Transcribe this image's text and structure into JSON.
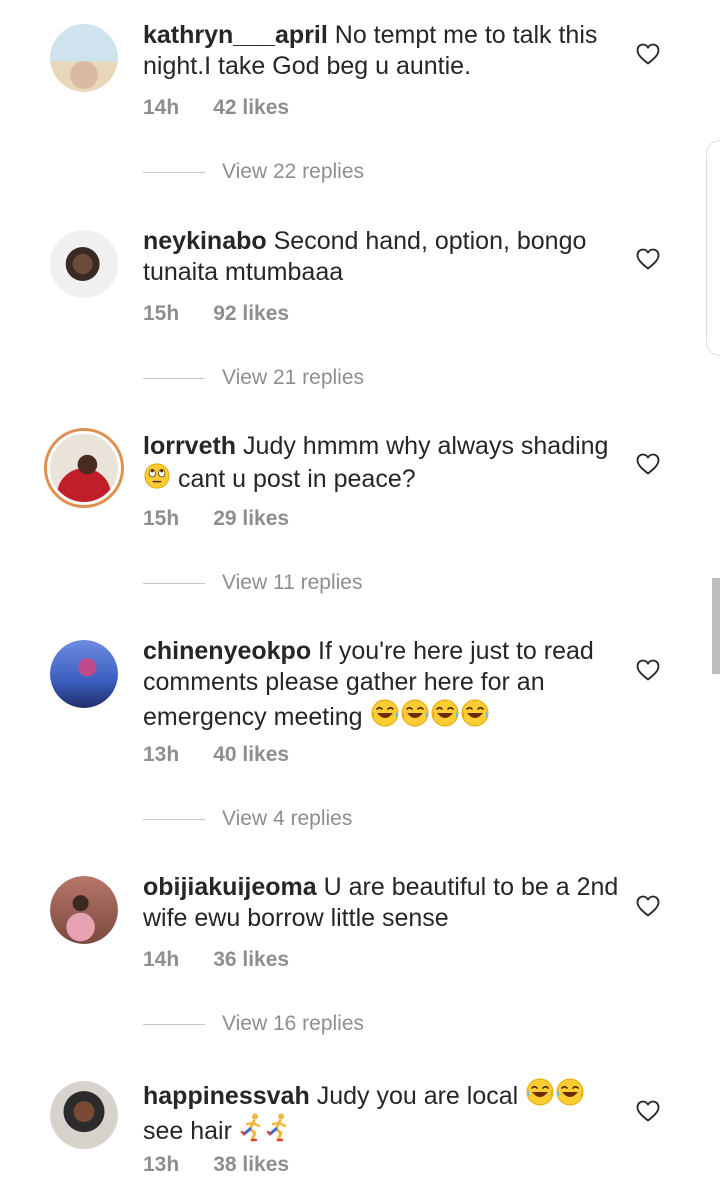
{
  "comments": [
    {
      "username": "kathryn___april",
      "text": "No tempt me to talk this night.I take God beg u auntie.",
      "time": "14h",
      "likes": "42 likes",
      "replies": "View 22 replies",
      "avatar_colors": [
        "#cfe3ef",
        "#d9b9a0"
      ]
    },
    {
      "username": "neykinabo",
      "text": "Second hand, option, bongo tunaita mtumbaaa",
      "time": "15h",
      "likes": "92 likes",
      "replies": "View 21 replies",
      "avatar_colors": [
        "#f0f0f0",
        "#3a2a24"
      ]
    },
    {
      "username": "lorrveth",
      "text": "Judy hmmm why always shading",
      "text_after_emoji": "cant u post in peace?",
      "time": "15h",
      "likes": "29 likes",
      "replies": "View 11 replies",
      "avatar_colors": [
        "#c21e2a",
        "#4a2b1f"
      ]
    },
    {
      "username": "chinenyeokpo",
      "text": "If you're here just to read comments please gather here for an emergency meeting",
      "time": "13h",
      "likes": "40 likes",
      "replies": "View 4 replies",
      "avatar_colors": [
        "#3b5fc0",
        "#c04a8c"
      ]
    },
    {
      "username": "obijiakuijeoma",
      "text": "U are beautiful  to be a 2nd wife ewu borrow  little  sense",
      "time": "14h",
      "likes": "36 likes",
      "replies": "View 16 replies",
      "avatar_colors": [
        "#b8766a",
        "#3c2a22"
      ]
    },
    {
      "username": "happinessvah",
      "text": "Judy you are local",
      "text_after_emoji": "see hair",
      "time": "13h",
      "likes": "38 likes",
      "avatar_colors": [
        "#2b2b2b",
        "#7a4a34"
      ]
    }
  ],
  "icons": {
    "like": "heart-outline-icon",
    "eye_roll_emoji": "face-with-rolling-eyes",
    "laugh_emoji": "face-with-tears-of-joy",
    "runner_emoji": "person-running"
  },
  "colors": {
    "text": "#262626",
    "secondary": "#8e8e8e",
    "divider": "#c7c7c7",
    "story_ring": "#e0904c"
  }
}
